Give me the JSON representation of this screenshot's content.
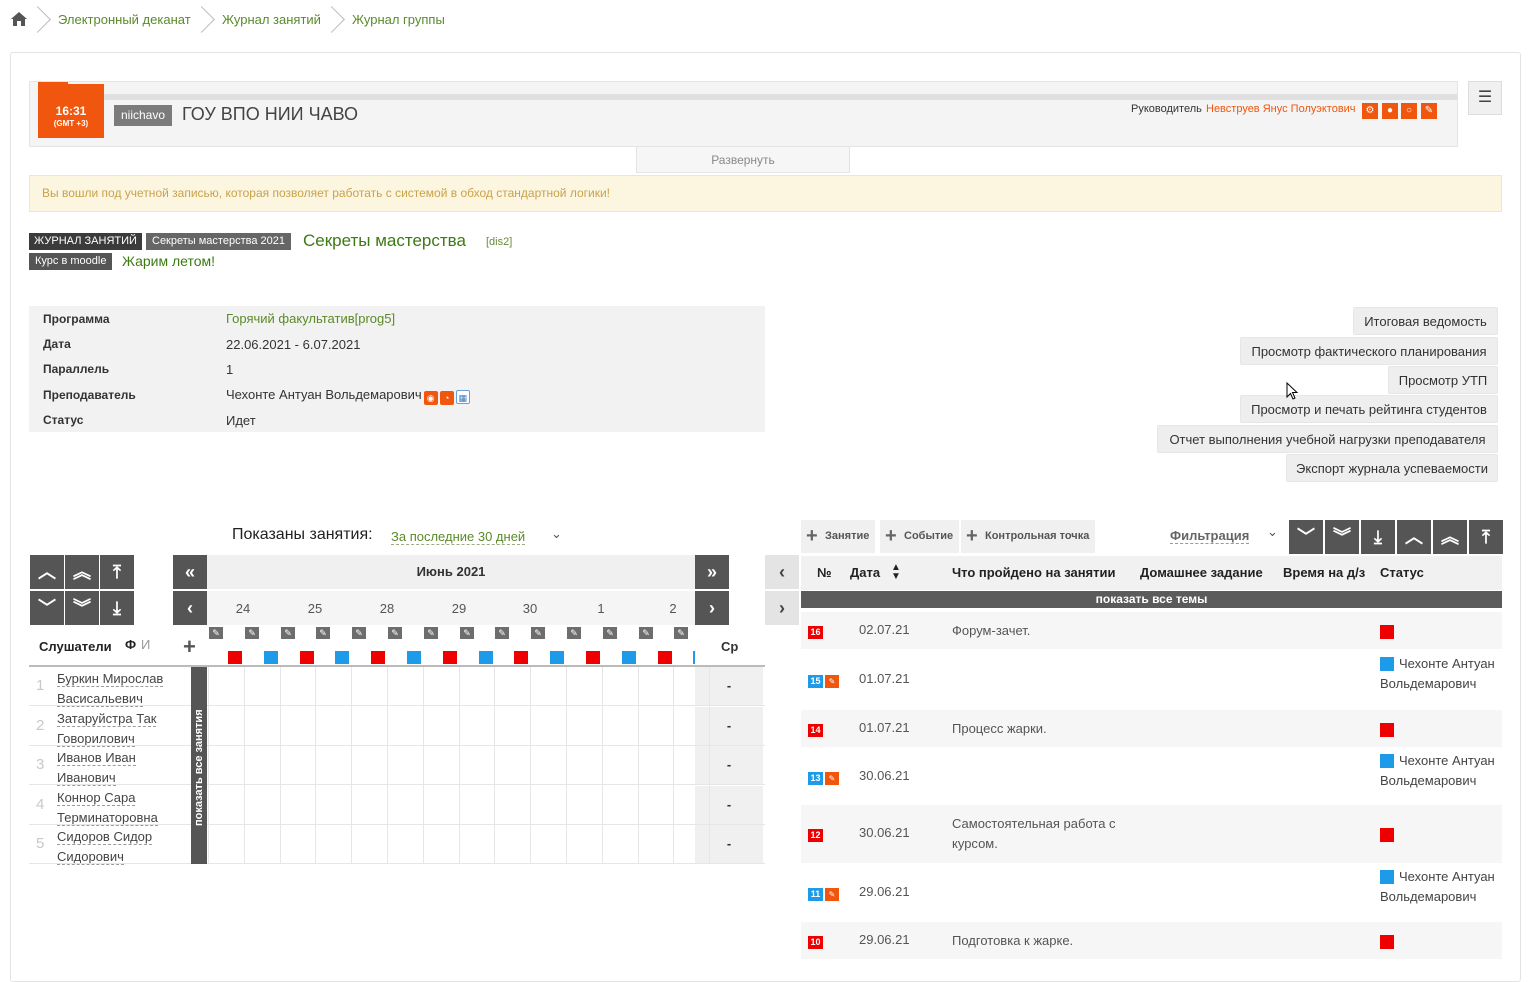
{
  "breadcrumb": {
    "home_icon": "home-icon",
    "items": [
      "Электронный деканат",
      "Журнал занятий",
      "Журнал группы"
    ]
  },
  "header": {
    "clock_time": "16:31",
    "clock_tz": "(GMT +3)",
    "org_code": "niichavo",
    "org_name": "ГОУ ВПО НИИ ЧАВО",
    "head_label": "Руководитель",
    "head_person": "Невструев Янус Полуэктович",
    "expand_label": "Развернуть"
  },
  "warning": "Вы вошли под учетной записью, которая позволяет работать с системой в обход стандартной логики!",
  "title": {
    "tag_journal": "ЖУРНАЛ ЗАНЯТИЙ",
    "tag_course": "Секреты мастерства 2021",
    "course_name": "Секреты мастерства",
    "course_code": "[dis2]",
    "tag_moodle": "Курс в moodle",
    "moodle_name": "Жарим летом!"
  },
  "info": {
    "program_label": "Программа",
    "program_value": "Горячий факультатив[prog5]",
    "date_label": "Дата",
    "date_value": "22.06.2021 - 6.07.2021",
    "parallel_label": "Параллель",
    "parallel_value": "1",
    "teacher_label": "Преподаватель",
    "teacher_value": "Чехонте Антуан Вольдемарович",
    "status_label": "Статус",
    "status_value": "Идет"
  },
  "actions": [
    "Итоговая ведомость",
    "Просмотр фактического планирования",
    "Просмотр УТП",
    "Просмотр и печать рейтинга студентов",
    "Отчет выполнения учебной нагрузки преподавателя",
    "Экспорт журнала успеваемости"
  ],
  "journal": {
    "shown_label": "Показаны занятия:",
    "shown_value": "За последние 30 дней",
    "month": "Июнь 2021",
    "days": [
      "24",
      "25",
      "28",
      "29",
      "30",
      "1",
      "2"
    ],
    "lesson_colors": [
      "red",
      "blue",
      "red",
      "blue",
      "red",
      "blue",
      "red",
      "blue",
      "red",
      "blue",
      "red",
      "blue",
      "red",
      "blue"
    ],
    "students_label": "Слушатели",
    "sort_f": "Ф",
    "sort_i": "И",
    "avg_label": "Ср",
    "show_all_vertical": "показать все занятия",
    "students": [
      {
        "num": "1",
        "name": "Буркин Мирослав Васисальевич",
        "avg": "-"
      },
      {
        "num": "2",
        "name": "Затаруйстра Так Говорилович",
        "avg": "-"
      },
      {
        "num": "3",
        "name": "Иванов Иван Иванович",
        "avg": "-"
      },
      {
        "num": "4",
        "name": "Коннор Сара Терминаторовна",
        "avg": "-"
      },
      {
        "num": "5",
        "name": "Сидоров Сидор Сидорович",
        "avg": "-"
      }
    ]
  },
  "lessons": {
    "toolbar": [
      "Занятие",
      "Событие",
      "Контрольная точка"
    ],
    "filter_label": "Фильтрация",
    "col_num": "№",
    "col_date": "Дата",
    "col_topic": "Что пройдено на занятии",
    "col_hw": "Домашнее задание",
    "col_time": "Время на д/з",
    "col_status": "Статус",
    "show_all_topics": "показать все темы",
    "rows": [
      {
        "num": "16",
        "type": "red",
        "date": "02.07.21",
        "topic": "Форум-зачет.",
        "status": ""
      },
      {
        "num": "15",
        "type": "blue",
        "date": "01.07.21",
        "topic": "",
        "status": "Чехонте Антуан Вольдемарович"
      },
      {
        "num": "14",
        "type": "red",
        "date": "01.07.21",
        "topic": "Процесс жарки.",
        "status": ""
      },
      {
        "num": "13",
        "type": "blue",
        "date": "30.06.21",
        "topic": "",
        "status": "Чехонте Антуан Вольдемарович"
      },
      {
        "num": "12",
        "type": "red",
        "date": "30.06.21",
        "topic": "Самостоятельная работа с курсом.",
        "status": ""
      },
      {
        "num": "11",
        "type": "blue",
        "date": "29.06.21",
        "topic": "",
        "status": "Чехонте Антуан Вольдемарович"
      },
      {
        "num": "10",
        "type": "red",
        "date": "29.06.21",
        "topic": "Подготовка к жарке.",
        "status": ""
      }
    ]
  },
  "colors": {
    "accent": "#f0560e",
    "link": "#5a8a2a",
    "red": "#ee0000",
    "blue": "#1e9be8"
  }
}
